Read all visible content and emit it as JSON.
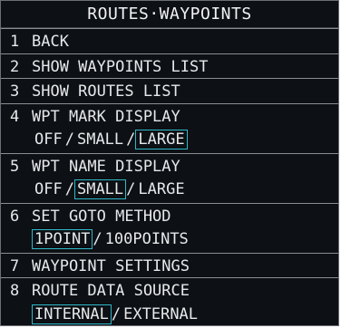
{
  "title": "ROUTES·WAYPOINTS",
  "colors": {
    "background": "#0d1014",
    "text": "#e6e8ea",
    "selection_border": "#2fb8c9",
    "divider": "#8a8e93"
  },
  "items": [
    {
      "number": "1",
      "label": "BACK"
    },
    {
      "number": "2",
      "label": "SHOW WAYPOINTS LIST"
    },
    {
      "number": "3",
      "label": "SHOW ROUTES LIST"
    },
    {
      "number": "4",
      "label": "WPT MARK DISPLAY",
      "options": [
        "OFF",
        "SMALL",
        "LARGE"
      ],
      "selected": "LARGE"
    },
    {
      "number": "5",
      "label": "WPT NAME DISPLAY",
      "options": [
        "OFF",
        "SMALL",
        "LARGE"
      ],
      "selected": "SMALL"
    },
    {
      "number": "6",
      "label": "SET GOTO METHOD",
      "options": [
        "1POINT",
        "100POINTS"
      ],
      "selected": "1POINT"
    },
    {
      "number": "7",
      "label": "WAYPOINT SETTINGS"
    },
    {
      "number": "8",
      "label": "ROUTE DATA SOURCE",
      "options": [
        "INTERNAL",
        "EXTERNAL"
      ],
      "selected": "INTERNAL"
    }
  ],
  "option_separator": "/"
}
